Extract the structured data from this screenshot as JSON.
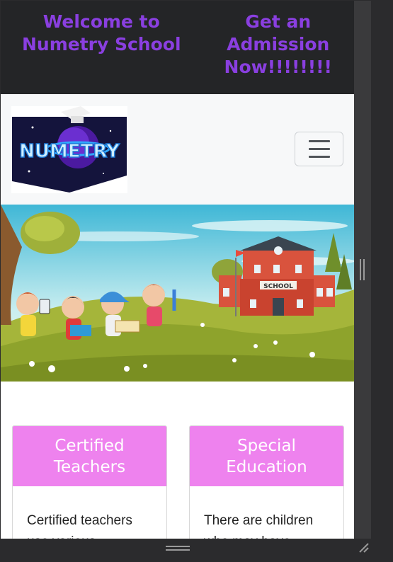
{
  "topbar": {
    "welcome": "Welcome to Numetry School",
    "admission": "Get an Admission Now!!!!!!!!"
  },
  "brand": {
    "logo_text": "NUMETRY",
    "logo_icon": "graduation-cap-planet-logo"
  },
  "nav": {
    "toggle_icon": "hamburger-menu-icon"
  },
  "hero": {
    "school_sign": "SCHOOL"
  },
  "cards": [
    {
      "title": "Certified Teachers",
      "body": "Certified teachers use various"
    },
    {
      "title": "Special Education",
      "body": "There are children who may have"
    }
  ],
  "colors": {
    "topbar_bg": "#242527",
    "accent_purple": "#8a3fe0",
    "card_header": "#ee82ee",
    "navbar_bg": "#f7f8f9"
  }
}
